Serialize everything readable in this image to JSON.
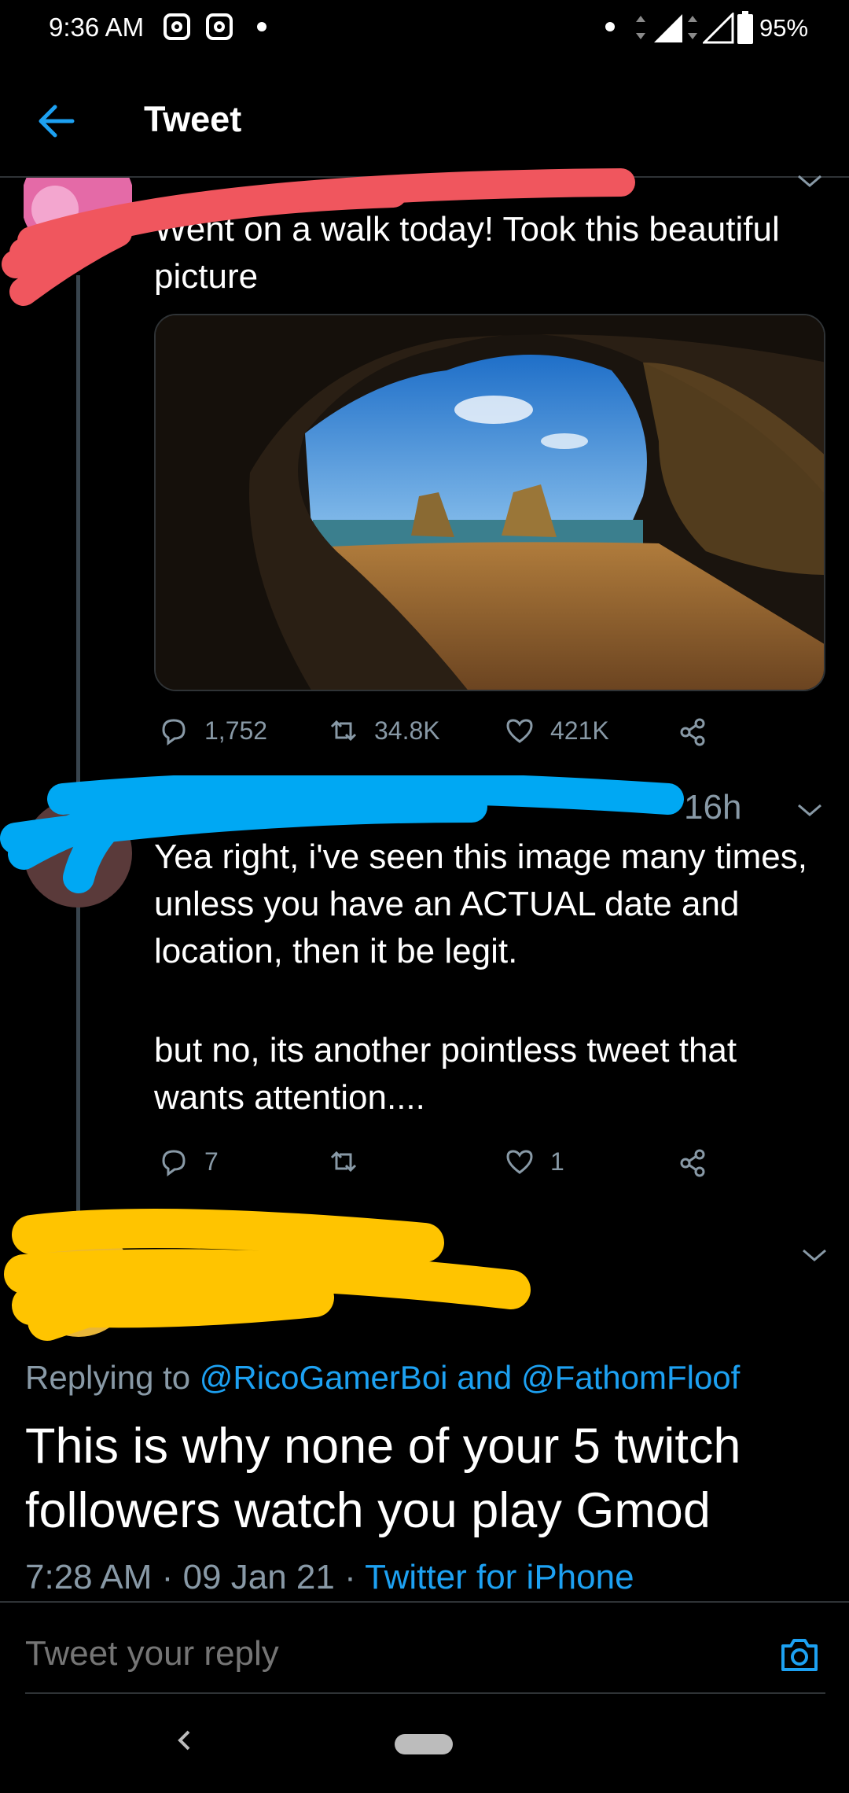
{
  "status_bar": {
    "time": "9:36 AM",
    "battery_percent": "95%",
    "icons": [
      "instagram-icon",
      "instagram-icon",
      "dot-icon",
      "dot-icon",
      "data-arrows-icon",
      "signal-icon",
      "signal-icon",
      "battery-icon"
    ]
  },
  "header": {
    "title": "Tweet",
    "back_icon": "arrow-left-icon"
  },
  "tweet1": {
    "text": "Went on a walk today! Took this beautiful picture",
    "image_alt": "cave-beach-photo",
    "actions": {
      "replies": "1,752",
      "retweets": "34.8K",
      "likes": "421K"
    }
  },
  "tweet2": {
    "time": "16h",
    "text_p1": "Yea right, i've seen this image many times, unless you have an ACTUAL date and location, then it be legit.",
    "text_p2": "but no, its another pointless tweet that wants attention....",
    "actions": {
      "replies": "7",
      "retweets": "",
      "likes": "1"
    }
  },
  "main_tweet": {
    "replying_prefix": "Replying to",
    "reply_user1": "@RicoGamerBoi",
    "reply_and": "and",
    "reply_user2": "@FathomFloof",
    "text": "This is why none of your 5 twitch followers watch you play Gmod",
    "time": "7:28 AM",
    "separator": "·",
    "date": "09 Jan 21",
    "source": "Twitter for iPhone"
  },
  "compose": {
    "placeholder": "Tweet your reply",
    "camera_icon": "camera-icon"
  },
  "colors": {
    "accent": "#1da1f2",
    "muted": "#8899a6",
    "divider": "#2f3336",
    "red_scribble": "#f0565e",
    "blue_scribble": "#00a8f3",
    "yellow_scribble": "#ffc400"
  }
}
